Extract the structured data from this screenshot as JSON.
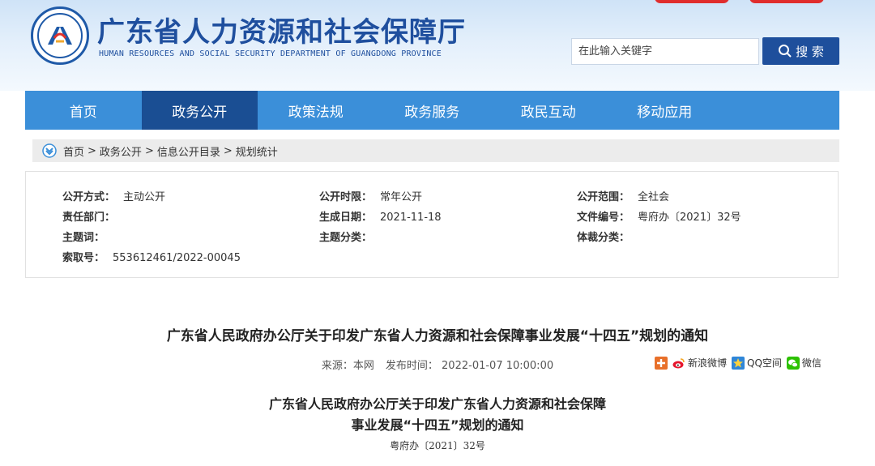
{
  "header": {
    "title": "广东省人力资源和社会保障厅",
    "subtitle": "HUMAN RESOURCES AND SOCIAL SECURITY DEPARTMENT OF GUANGDONG PROVINCE",
    "search_placeholder": "在此输入关键字",
    "search_button": "搜 索"
  },
  "nav": {
    "items": [
      "首页",
      "政务公开",
      "政策法规",
      "政务服务",
      "政民互动",
      "移动应用"
    ],
    "active_index": 1
  },
  "breadcrumb": {
    "items": [
      "首页",
      "政务公开",
      "信息公开目录",
      "规划统计"
    ],
    "separator": ">"
  },
  "meta": {
    "disclosure_method_label": "公开方式：",
    "disclosure_method_value": "主动公开",
    "disclosure_period_label": "公开时限：",
    "disclosure_period_value": "常年公开",
    "disclosure_scope_label": "公开范围：",
    "disclosure_scope_value": "全社会",
    "dept_label": "责任部门：",
    "dept_value": "",
    "date_label": "生成日期：",
    "date_value": "2021-11-18",
    "file_no_label": "文件编号：",
    "file_no_value": "粤府办〔2021〕32号",
    "subject_label": "主题词：",
    "subject_value": "",
    "category_label": "主题分类：",
    "category_value": "",
    "genre_label": "体裁分类：",
    "genre_value": "",
    "index_label": "索取号：",
    "index_value": "553612461/2022-00045"
  },
  "article": {
    "title": "广东省人民政府办公厅关于印发广东省人力资源和社会保障事业发展“十四五”规划的通知",
    "source": "来源：本网",
    "publish_time": "发布时间： 2022-01-07 10:00:00",
    "doc_title_line1": "广东省人民政府办公厅关于印发广东省人力资源和社会保障",
    "doc_title_line2": "事业发展“十四五”规划的通知",
    "doc_number": "粤府办〔2021〕32号"
  },
  "share": {
    "weibo": "新浪微博",
    "qzone": "QQ空间",
    "wechat": "微信"
  },
  "colors": {
    "nav_bg": "#3b8fd9",
    "nav_active": "#1a4e93",
    "search_btn": "#1e4f9c",
    "title_blue": "#1f4f9e"
  }
}
